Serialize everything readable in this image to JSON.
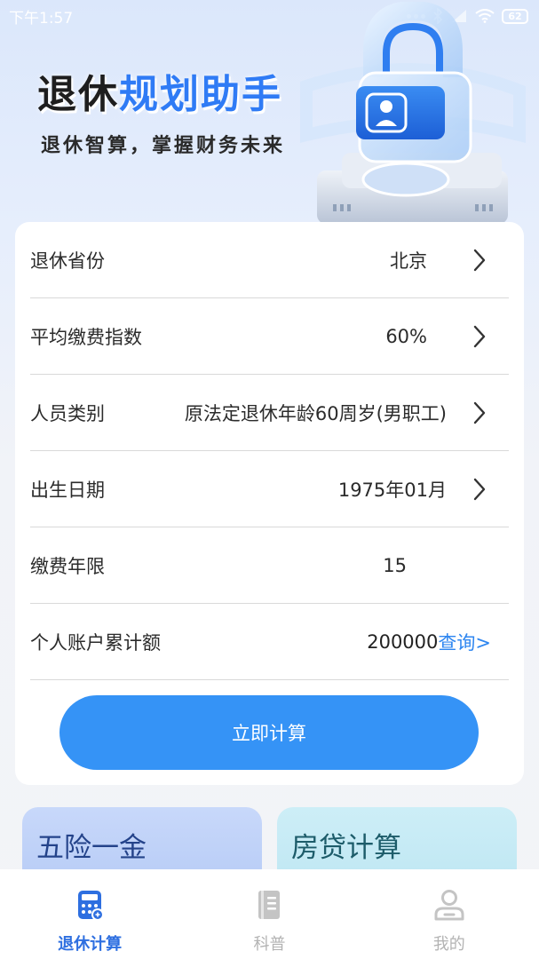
{
  "status_bar": {
    "time": "下午1:57",
    "battery": "62"
  },
  "header": {
    "title_part1": "退休",
    "title_part2": "规划助手",
    "subtitle": "退休智算，掌握财务未来"
  },
  "form": {
    "rows": [
      {
        "label": "退休省份",
        "value": "北京"
      },
      {
        "label": "平均缴费指数",
        "value": "60%"
      },
      {
        "label": "人员类别",
        "value": "原法定退休年龄60周岁(男职工)"
      },
      {
        "label": "出生日期",
        "value": "1975年01月"
      },
      {
        "label": "缴费年限",
        "value": "15"
      },
      {
        "label": "个人账户累计额",
        "value": "200000",
        "action": "查询>"
      }
    ],
    "submit_label": "立即计算"
  },
  "tiles": [
    {
      "label": "五险一金"
    },
    {
      "label": "房贷计算"
    }
  ],
  "nav": {
    "items": [
      {
        "label": "退休计算",
        "icon": "calculator-icon",
        "active": true
      },
      {
        "label": "科普",
        "icon": "book-icon",
        "active": false
      },
      {
        "label": "我的",
        "icon": "user-icon",
        "active": false
      }
    ]
  },
  "colors": {
    "accent": "#3593f6",
    "nav_active": "#2e6fe0",
    "nav_inactive": "#b3b3b3"
  }
}
